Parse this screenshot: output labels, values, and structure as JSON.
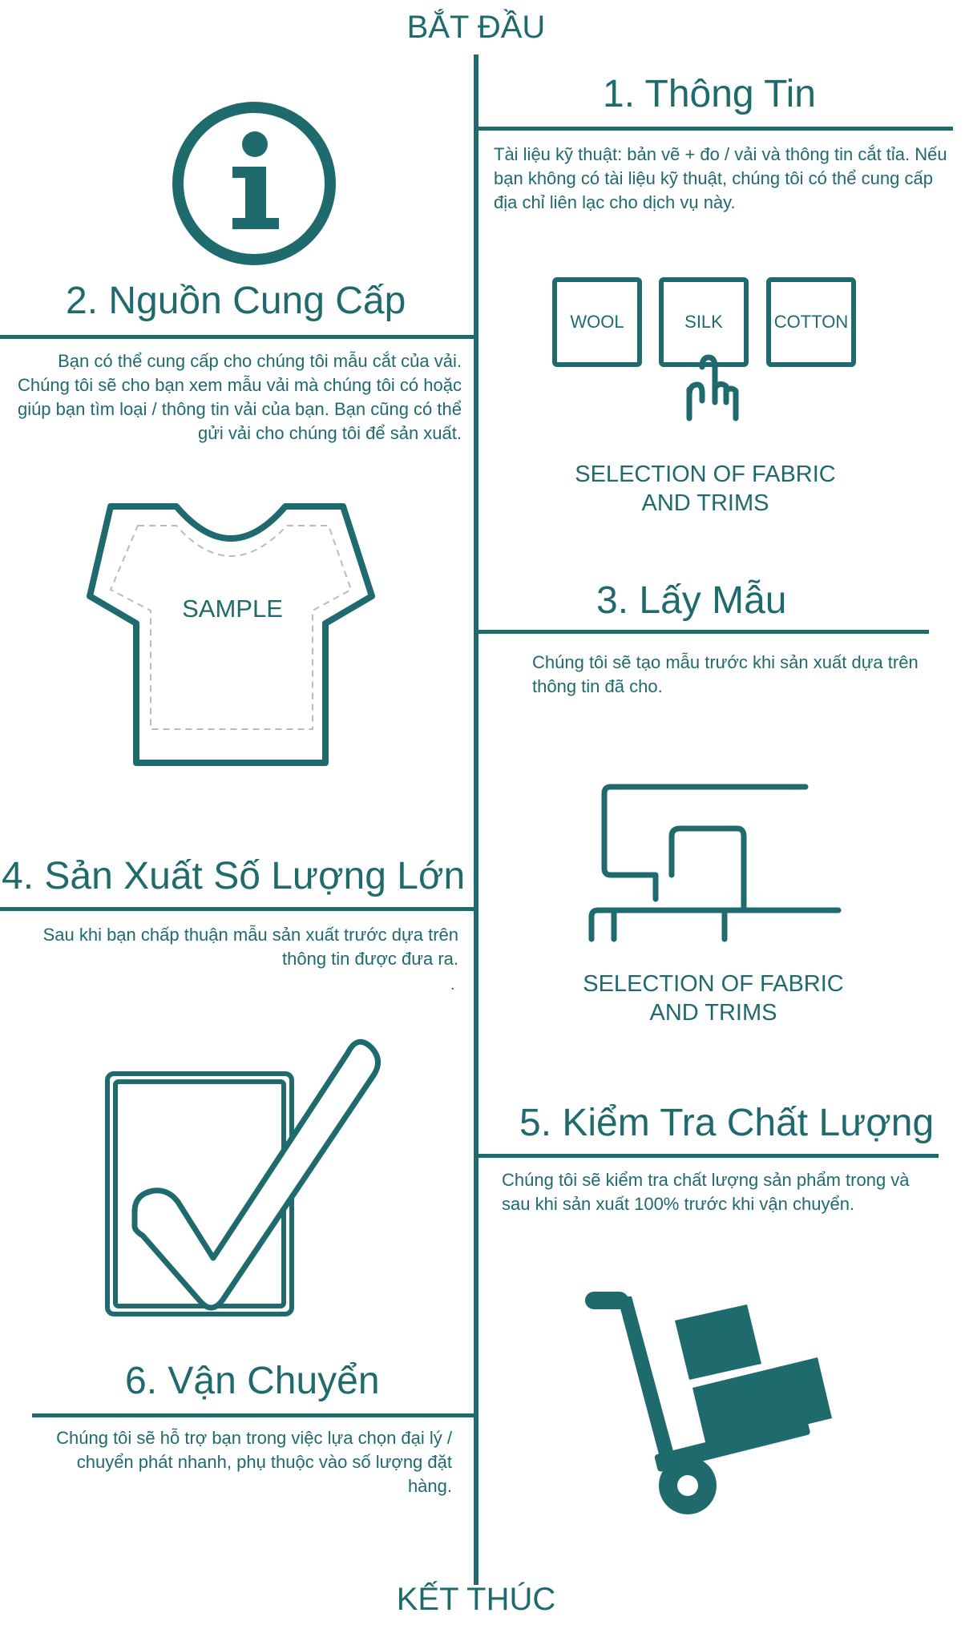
{
  "start_label": "BẮT ĐẦU",
  "end_label": "KẾT THÚC",
  "steps": [
    {
      "title": "1. Thông Tin",
      "text": "Tài liệu kỹ thuật: bản vẽ + đo / vải và thông tin cắt tỉa. Nếu bạn không có tài liệu kỹ thuật, chúng tôi có thể cung cấp địa chỉ liên lạc cho dịch vụ này."
    },
    {
      "title": "2. Nguồn Cung Cấp",
      "text": "Bạn có thể cung cấp cho chúng tôi  mẫu cắt của vải. Chúng tôi sẽ cho bạn xem mẫu vải mà chúng tôi có hoặc giúp bạn tìm loại / thông tin vải của bạn. Bạn cũng có thể gửi vải cho chúng tôi để sản xuất."
    },
    {
      "title": "3. Lấy Mẫu",
      "text": "Chúng tôi sẽ tạo mẫu trước khi sản xuất dựa trên thông tin đã cho."
    },
    {
      "title": "4. Sản Xuất Số Lượng Lớn",
      "text": "Sau khi bạn chấp thuận mẫu sản xuất trước dựa trên thông tin được đưa ra."
    },
    {
      "title": "5. Kiểm Tra Chất Lượng",
      "text": "Chúng tôi sẽ kiểm tra chất lượng sản phẩm trong và sau khi sản xuất 100% trước khi vận chuyển."
    },
    {
      "title": "6. Vận Chuyển",
      "text": "Chúng tôi sẽ hỗ trợ bạn trong việc lựa chọn đại lý / chuyển phát nhanh, phụ thuộc vào số lượng đặt hàng."
    }
  ],
  "fabrics": [
    "WOOL",
    "SILK",
    "COTTON"
  ],
  "fabric_caption": {
    "line1": "SELECTION OF FABRIC",
    "line2": "AND TRIMS"
  },
  "sewing_caption": {
    "line1": "SELECTION OF FABRIC",
    "line2": "AND TRIMS"
  },
  "sample_label": "SAMPLE",
  "step4_dot": ".",
  "colors": {
    "accent": "#1f6a6d",
    "background": "#ffffff"
  },
  "icons": [
    "info-icon",
    "fabric-selection-icon",
    "tshirt-icon",
    "sewing-machine-icon",
    "checkbox-check-icon",
    "hand-truck-icon"
  ]
}
